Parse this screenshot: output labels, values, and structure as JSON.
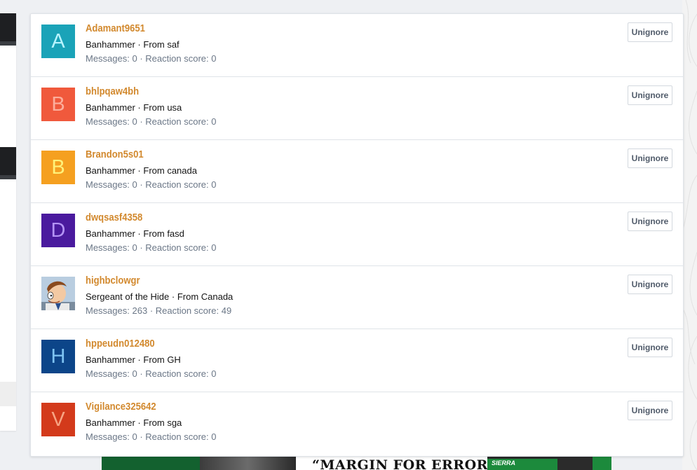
{
  "users": [
    {
      "username": "Adamant9651",
      "initial": "A",
      "avatar_bg": "#1aa3b8",
      "avatar_fg": "#b8f4ff",
      "user_title": "Banhammer",
      "location": "From saf",
      "messages_label": "Messages:",
      "messages": "0",
      "reaction_label": "Reaction score:",
      "reaction_score": "0",
      "button_label": "Unignore"
    },
    {
      "username": "bhlpqaw4bh",
      "initial": "B",
      "avatar_bg": "#f0593c",
      "avatar_fg": "#fcae9c",
      "user_title": "Banhammer",
      "location": "From usa",
      "messages_label": "Messages:",
      "messages": "0",
      "reaction_label": "Reaction score:",
      "reaction_score": "0",
      "button_label": "Unignore"
    },
    {
      "username": "Brandon5s01",
      "initial": "B",
      "avatar_bg": "#f5a020",
      "avatar_fg": "#fff27a",
      "user_title": "Banhammer",
      "location": "From canada",
      "messages_label": "Messages:",
      "messages": "0",
      "reaction_label": "Reaction score:",
      "reaction_score": "0",
      "button_label": "Unignore"
    },
    {
      "username": "dwqsasf4358",
      "initial": "D",
      "avatar_bg": "#4a1a9e",
      "avatar_fg": "#b493f5",
      "user_title": "Banhammer",
      "location": "From fasd",
      "messages_label": "Messages:",
      "messages": "0",
      "reaction_label": "Reaction score:",
      "reaction_score": "0",
      "button_label": "Unignore"
    },
    {
      "username": "highbclowgr",
      "initial": "",
      "avatar_bg": "",
      "avatar_fg": "",
      "avatar_icon": "cartoon-avatar-icon",
      "user_title": "Sergeant of the Hide",
      "location": "From Canada",
      "messages_label": "Messages:",
      "messages": "263",
      "reaction_label": "Reaction score:",
      "reaction_score": "49",
      "button_label": "Unignore"
    },
    {
      "username": "hppeudn012480",
      "initial": "H",
      "avatar_bg": "#0c4589",
      "avatar_fg": "#7ec3f2",
      "user_title": "Banhammer",
      "location": "From GH",
      "messages_label": "Messages:",
      "messages": "0",
      "reaction_label": "Reaction score:",
      "reaction_score": "0",
      "button_label": "Unignore"
    },
    {
      "username": "Vigilance325642",
      "initial": "V",
      "avatar_bg": "#d33a1b",
      "avatar_fg": "#f7a483",
      "user_title": "Banhammer",
      "location": "From sga",
      "messages_label": "Messages:",
      "messages": "0",
      "reaction_label": "Reaction score:",
      "reaction_score": "0",
      "button_label": "Unignore"
    }
  ],
  "separator": " · ",
  "ad": {
    "headline": "“MARGIN FOR ERROR?”",
    "box_label": "SIERRA"
  },
  "colors": {
    "username": "#d2892e",
    "stats_text": "#6b7787",
    "card_border": "#dfe3e8"
  }
}
